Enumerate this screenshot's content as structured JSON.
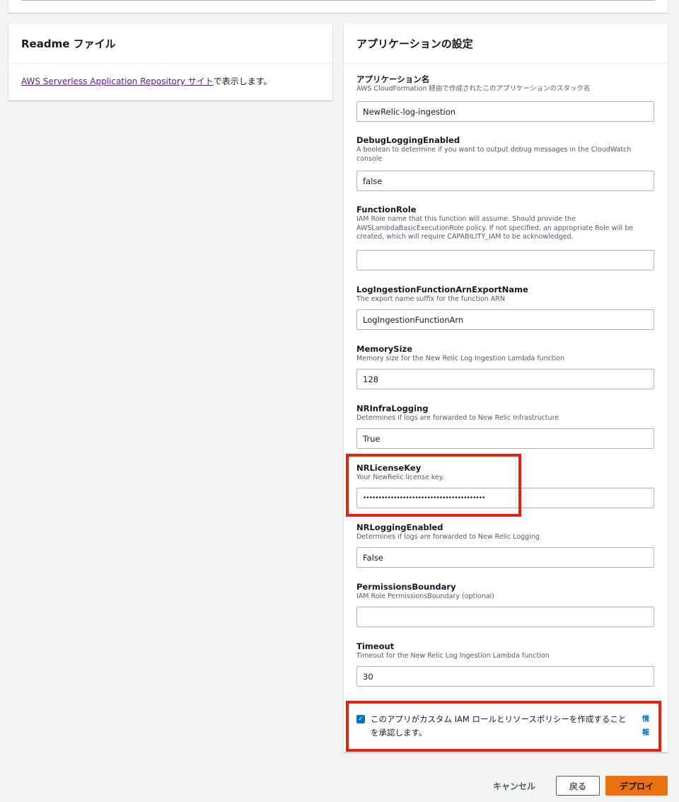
{
  "readme": {
    "title": "Readme ファイル",
    "link_text": "AWS Serverless Application Repository サイト",
    "suffix_text": "で表示します。"
  },
  "settings": {
    "title": "アプリケーションの設定",
    "fields": [
      {
        "label": "アプリケーション名",
        "desc": "AWS CloudFormation 経由で作成されたこのアプリケーションのスタック名",
        "value": "NewRelic-log-ingestion"
      },
      {
        "label": "DebugLoggingEnabled",
        "desc": "A boolean to determine if you want to output debug messages in the CloudWatch console",
        "value": "false"
      },
      {
        "label": "FunctionRole",
        "desc": "IAM Role name that this function will assume. Should provide the AWSLambdaBasicExecutionRole policy. If not specified, an appropriate Role will be created, which will require CAPABILITY_IAM to be acknowledged.",
        "value": ""
      },
      {
        "label": "LogIngestionFunctionArnExportName",
        "desc": "The export name suffix for the function ARN",
        "value": "LogIngestionFunctionArn"
      },
      {
        "label": "MemorySize",
        "desc": "Memory size for the New Relic Log Ingestion Lambda function",
        "value": "128"
      },
      {
        "label": "NRInfraLogging",
        "desc": "Determines if logs are forwarded to New Relic Infrastructure",
        "value": "True"
      },
      {
        "label": "NRLicenseKey",
        "desc": "Your NewRelic license key.",
        "value": "••••••••••••••••••••••••••••••••••••••••"
      },
      {
        "label": "NRLoggingEnabled",
        "desc": "Determines if logs are forwarded to New Relic Logging",
        "value": "False"
      },
      {
        "label": "PermissionsBoundary",
        "desc": "IAM Role PermissionsBoundary (optional)",
        "value": ""
      },
      {
        "label": "Timeout",
        "desc": "Timeout for the New Relic Log Ingestion Lambda function",
        "value": "30"
      }
    ],
    "acknowledge": {
      "checked": true,
      "text": "このアプリがカスタム IAM ロールとリソースポリシーを作成することを承認します。",
      "info_link": "情報"
    }
  },
  "footer": {
    "cancel_label": "キャンセル",
    "back_label": "戻る",
    "deploy_label": "デプロイ"
  },
  "colors": {
    "highlight": "#e8210f",
    "primary_button": "#ec7211",
    "link": "#0073bb",
    "visited_link": "#5a1b8a"
  }
}
